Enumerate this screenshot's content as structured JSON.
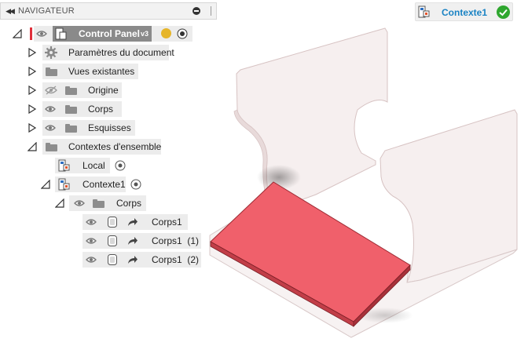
{
  "navigator": {
    "title": "NAVIGATEUR",
    "collapse_glyph": "◀◀"
  },
  "tree": {
    "root": {
      "label": "Control Panel",
      "version": "v3"
    },
    "items": [
      {
        "label": "Paramètres du document",
        "icon": "gear-icon"
      },
      {
        "label": "Vues existantes",
        "icon": "folder-icon"
      },
      {
        "label": "Origine",
        "icon": "folder-icon",
        "visibility": "hidden"
      },
      {
        "label": "Corps",
        "icon": "folder-icon"
      },
      {
        "label": "Esquisses",
        "icon": "folder-icon"
      },
      {
        "label": "Contextes d'ensemble",
        "icon": "folder-icon"
      },
      {
        "label": "Local",
        "icon": "context-icon"
      },
      {
        "label": "Contexte1",
        "icon": "context-icon"
      },
      {
        "label": "Corps",
        "icon": "folder-icon"
      },
      {
        "label": "Corps1",
        "icon": "body-icon"
      },
      {
        "label": "Corps1  (1)",
        "icon": "body-icon"
      },
      {
        "label": "Corps1  (2)",
        "icon": "body-icon"
      }
    ]
  },
  "context_chip": {
    "label": "Contexte1",
    "status": "active"
  },
  "colors": {
    "accent": "#1a83c4",
    "success": "#2fa72f",
    "highlight_body": "#f0606b",
    "panel_fill": "#f5eeee"
  }
}
